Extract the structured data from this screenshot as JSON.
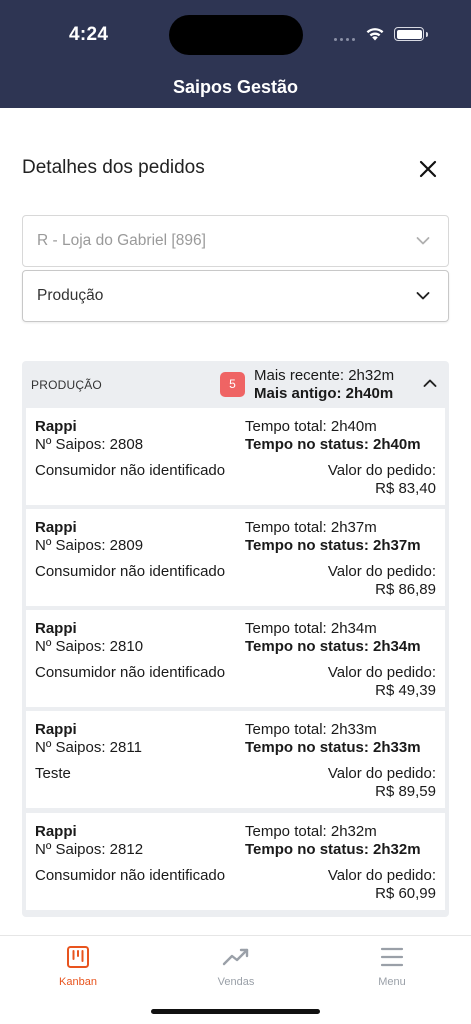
{
  "status_bar": {
    "time": "4:24"
  },
  "app": {
    "title": "Saipos Gestão"
  },
  "page": {
    "title": "Detalhes dos pedidos"
  },
  "filters": {
    "store": {
      "value": "R - Loja do Gabriel [896]",
      "disabled": true
    },
    "stage": {
      "value": "Produção"
    }
  },
  "group": {
    "label": "PRODUÇÃO",
    "count": "5",
    "recent": "Mais recente: 2h32m",
    "oldest": "Mais antigo: 2h40m"
  },
  "orders": [
    {
      "store": "Rappi",
      "number": "Nº Saipos: 2808",
      "customer": "Consumidor não identificado",
      "total_time": "Tempo total: 2h40m",
      "status_time": "Tempo no status: 2h40m",
      "value_label": "Valor do pedido:",
      "value": "R$ 83,40"
    },
    {
      "store": "Rappi",
      "number": "Nº Saipos: 2809",
      "customer": "Consumidor não identificado",
      "total_time": "Tempo total: 2h37m",
      "status_time": "Tempo no status: 2h37m",
      "value_label": "Valor do pedido:",
      "value": "R$ 86,89"
    },
    {
      "store": "Rappi",
      "number": "Nº Saipos: 2810",
      "customer": "Consumidor não identificado",
      "total_time": "Tempo total: 2h34m",
      "status_time": "Tempo no status: 2h34m",
      "value_label": "Valor do pedido:",
      "value": "R$ 49,39"
    },
    {
      "store": "Rappi",
      "number": "Nº Saipos: 2811",
      "customer": "Teste",
      "total_time": "Tempo total: 2h33m",
      "status_time": "Tempo no status: 2h33m",
      "value_label": "Valor do pedido:",
      "value": "R$ 89,59"
    },
    {
      "store": "Rappi",
      "number": "Nº Saipos: 2812",
      "customer": "Consumidor não identificado",
      "total_time": "Tempo total: 2h32m",
      "status_time": "Tempo no status: 2h32m",
      "value_label": "Valor do pedido:",
      "value": "R$ 60,99"
    }
  ],
  "tabs": [
    {
      "label": "Kanban",
      "icon": "kanban-icon",
      "active": true
    },
    {
      "label": "Vendas",
      "icon": "trend-up-icon",
      "active": false
    },
    {
      "label": "Menu",
      "icon": "hamburger-icon",
      "active": false
    }
  ],
  "colors": {
    "header_bg": "#2e3553",
    "accent": "#e8541e",
    "badge": "#ef6464",
    "group_bg": "#eceef1"
  }
}
